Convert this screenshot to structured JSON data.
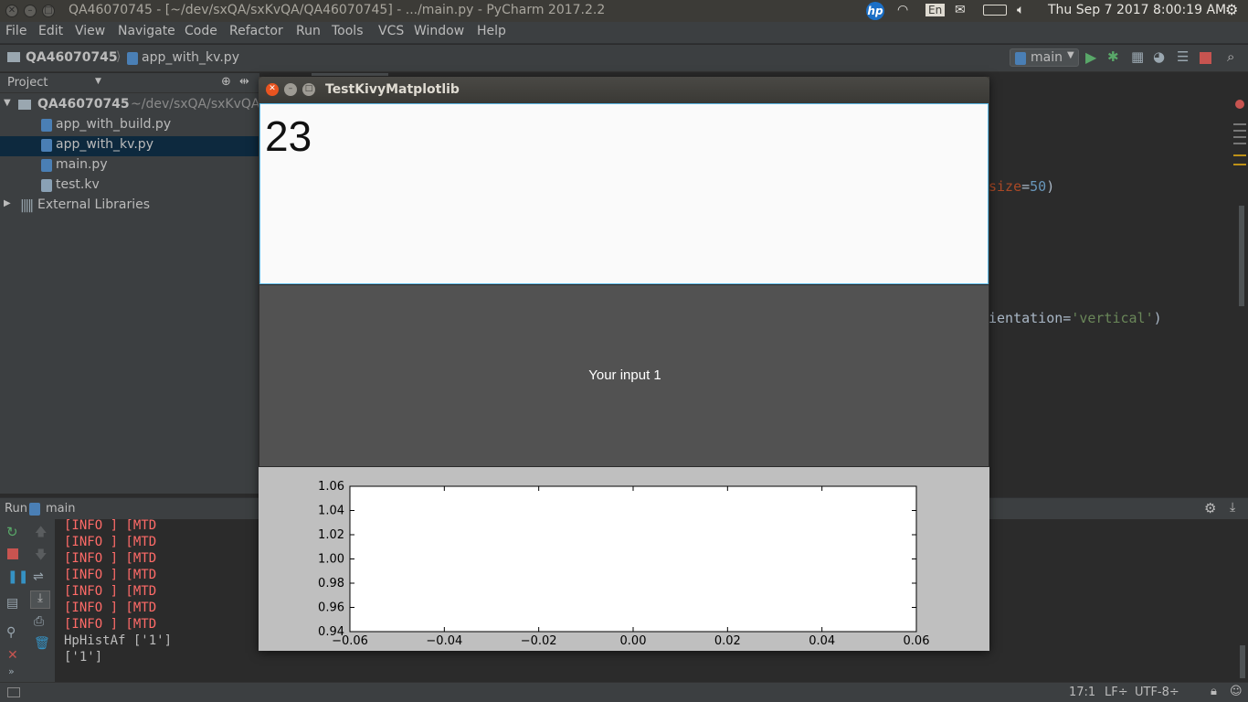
{
  "os": {
    "window_title": "QA46070745 - [~/dev/sxQA/sxKvQA/QA46070745] - .../main.py - PyCharm 2017.2.2",
    "keyboard_layout": "En",
    "datetime": "Thu Sep  7 2017  8:00:19 AM"
  },
  "menu": {
    "file": "File",
    "edit": "Edit",
    "view": "View",
    "navigate": "Navigate",
    "code": "Code",
    "refactor": "Refactor",
    "run": "Run",
    "tools": "Tools",
    "vcs": "VCS",
    "window": "Window",
    "help": "Help"
  },
  "nav": {
    "project": "QA46070745",
    "file": "app_with_kv.py",
    "run_config": "main"
  },
  "project_panel": {
    "header": "Project",
    "root": "QA46070745",
    "root_path": "~/dev/sxQA/sxKvQA",
    "files": [
      "app_with_build.py",
      "app_with_kv.py",
      "main.py",
      "test.kv"
    ],
    "external": "External Libraries"
  },
  "editor": {
    "line1_a": "size",
    "line1_b": "=",
    "line1_c": "50",
    "line1_d": ")",
    "line2_a": "ientation=",
    "line2_b": "'vertical'",
    "line2_c": ")"
  },
  "run_panel": {
    "label": "Run",
    "config": "main",
    "log_lines": [
      "[INFO   ] [MTD",
      "[INFO   ] [MTD",
      "[INFO   ] [MTD",
      "[INFO   ] [MTD",
      "[INFO   ] [MTD",
      "[INFO   ] [MTD",
      "[INFO   ] [MTD"
    ],
    "output_lines": [
      "HpHistAf ['1']",
      "['1']"
    ]
  },
  "status": {
    "position": "17:1",
    "line_sep": "LF÷",
    "encoding": "UTF-8÷"
  },
  "kivy": {
    "title": "TestKivyMatplotlib",
    "input_value": "23",
    "label_text": "Your input 1"
  },
  "chart_data": {
    "type": "line",
    "series": [],
    "x_ticks": [
      "−0.06",
      "−0.04",
      "−0.02",
      "0.00",
      "0.02",
      "0.04",
      "0.06"
    ],
    "y_ticks": [
      "1.06",
      "1.04",
      "1.02",
      "1.00",
      "0.98",
      "0.96",
      "0.94"
    ],
    "xlim": [
      -0.06,
      0.06
    ],
    "ylim": [
      0.94,
      1.06
    ],
    "grid": false,
    "title": "",
    "xlabel": "",
    "ylabel": ""
  },
  "colors": {
    "accent_selection": "#0d293e",
    "log_text": "#ff6b68",
    "input_border": "#5bb9e8"
  }
}
